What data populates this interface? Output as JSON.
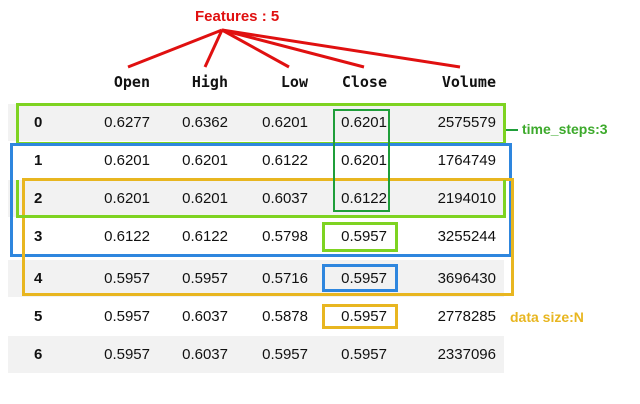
{
  "annotations": {
    "features": "Features : 5",
    "time_steps": "time_steps:3",
    "data_size": "data  size:N"
  },
  "table": {
    "columns": [
      "Open",
      "High",
      "Low",
      "Close",
      "Volume"
    ],
    "rows": [
      {
        "index": "0",
        "values": [
          "0.6277",
          "0.6362",
          "0.6201",
          "0.6201",
          "2575579"
        ]
      },
      {
        "index": "1",
        "values": [
          "0.6201",
          "0.6201",
          "0.6122",
          "0.6201",
          "1764749"
        ]
      },
      {
        "index": "2",
        "values": [
          "0.6201",
          "0.6201",
          "0.6037",
          "0.6122",
          "2194010"
        ]
      },
      {
        "index": "3",
        "values": [
          "0.6122",
          "0.6122",
          "0.5798",
          "0.5957",
          "3255244"
        ]
      },
      {
        "index": "4",
        "values": [
          "0.5957",
          "0.5957",
          "0.5716",
          "0.5957",
          "3696430"
        ]
      },
      {
        "index": "5",
        "values": [
          "0.5957",
          "0.6037",
          "0.5878",
          "0.5957",
          "2778285"
        ]
      },
      {
        "index": "6",
        "values": [
          "0.5957",
          "0.6037",
          "0.5957",
          "0.5957",
          "2337096"
        ]
      }
    ]
  },
  "colors": {
    "features": "#e01010",
    "time_steps": "#3daa2c",
    "data_size": "#e8b620",
    "window_2": "#2e86de",
    "close_col": "#1f9e3a"
  }
}
